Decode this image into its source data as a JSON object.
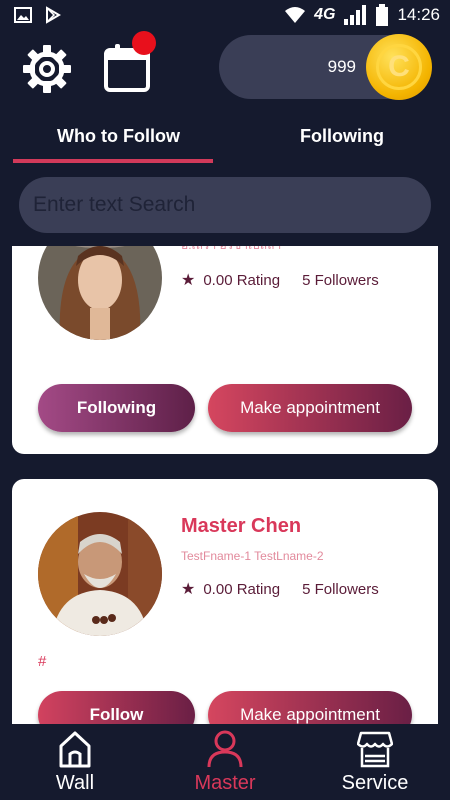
{
  "status_bar": {
    "network": "4G",
    "time": "14:26"
  },
  "header": {
    "coin_balance": "999",
    "coin_symbol": "C",
    "notification_dot_color": "#e8101c"
  },
  "tabs": [
    {
      "label": "Who to Follow",
      "active": true
    },
    {
      "label": "Following",
      "active": false
    }
  ],
  "search": {
    "placeholder": "Enter text Search",
    "value": ""
  },
  "cards": [
    {
      "name": "",
      "subtitle": "อ.เลรา อริชาเบิลลา",
      "rating": "0.00 Rating",
      "followers": "5 Followers",
      "primary_button": "Following",
      "secondary_button": "Make appointment"
    },
    {
      "name": "Master Chen",
      "subtitle": "TestFname-1 TestLname-2",
      "rating": "0.00 Rating",
      "followers": "5 Followers",
      "description": "#",
      "primary_button": "Follow",
      "secondary_button": "Make appointment"
    }
  ],
  "bottom_nav": [
    {
      "label": "Wall",
      "icon": "home-icon",
      "active": false
    },
    {
      "label": "Master",
      "icon": "person-icon",
      "active": true
    },
    {
      "label": "Service",
      "icon": "store-icon",
      "active": false
    }
  ],
  "colors": {
    "background": "#151a2e",
    "accent": "#d9385a",
    "pill": "#3a3e56",
    "coin": "#f4b400"
  }
}
